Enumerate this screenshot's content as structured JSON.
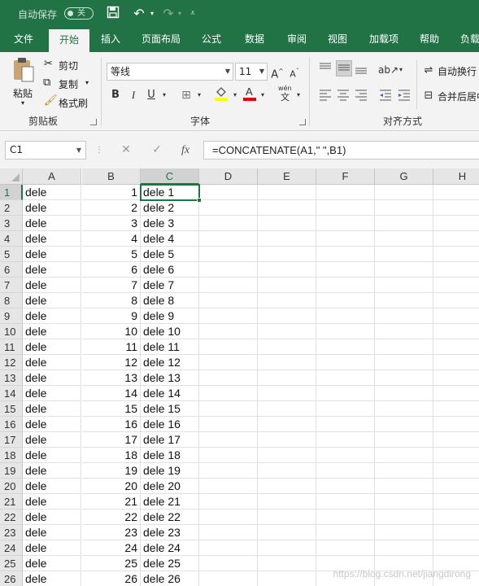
{
  "titlebar": {
    "autosave_label": "自动保存",
    "autosave_state": "关"
  },
  "tabs": [
    "文件",
    "开始",
    "插入",
    "页面布局",
    "公式",
    "数据",
    "审阅",
    "视图",
    "加载项",
    "帮助",
    "负载"
  ],
  "ribbon": {
    "clipboard": {
      "paste": "粘贴",
      "cut": "剪切",
      "copy": "复制",
      "format_painter": "格式刷",
      "group_label": "剪贴板"
    },
    "font": {
      "font_name": "等线",
      "font_size": "11",
      "bold": "B",
      "italic": "I",
      "underline": "U",
      "group_label": "字体"
    },
    "alignment": {
      "wrap_text": "自动换行",
      "merge_center": "合并后居中",
      "group_label": "对齐方式"
    }
  },
  "formula_bar": {
    "name_box": "C1",
    "formula": "=CONCATENATE(A1,\" \",B1)"
  },
  "sheet": {
    "columns": [
      "A",
      "B",
      "C",
      "D",
      "E",
      "F",
      "G",
      "H"
    ],
    "selected_cell": "C1",
    "rows": [
      {
        "n": "1",
        "a": "dele",
        "b": "1",
        "c": "dele 1"
      },
      {
        "n": "2",
        "a": "dele",
        "b": "2",
        "c": "dele 2"
      },
      {
        "n": "3",
        "a": "dele",
        "b": "3",
        "c": "dele 3"
      },
      {
        "n": "4",
        "a": "dele",
        "b": "4",
        "c": "dele 4"
      },
      {
        "n": "5",
        "a": "dele",
        "b": "5",
        "c": "dele 5"
      },
      {
        "n": "6",
        "a": "dele",
        "b": "6",
        "c": "dele 6"
      },
      {
        "n": "7",
        "a": "dele",
        "b": "7",
        "c": "dele 7"
      },
      {
        "n": "8",
        "a": "dele",
        "b": "8",
        "c": "dele 8"
      },
      {
        "n": "9",
        "a": "dele",
        "b": "9",
        "c": "dele 9"
      },
      {
        "n": "10",
        "a": "dele",
        "b": "10",
        "c": "dele 10"
      },
      {
        "n": "11",
        "a": "dele",
        "b": "11",
        "c": "dele 11"
      },
      {
        "n": "12",
        "a": "dele",
        "b": "12",
        "c": "dele 12"
      },
      {
        "n": "13",
        "a": "dele",
        "b": "13",
        "c": "dele 13"
      },
      {
        "n": "14",
        "a": "dele",
        "b": "14",
        "c": "dele 14"
      },
      {
        "n": "15",
        "a": "dele",
        "b": "15",
        "c": "dele 15"
      },
      {
        "n": "16",
        "a": "dele",
        "b": "16",
        "c": "dele 16"
      },
      {
        "n": "17",
        "a": "dele",
        "b": "17",
        "c": "dele 17"
      },
      {
        "n": "18",
        "a": "dele",
        "b": "18",
        "c": "dele 18"
      },
      {
        "n": "19",
        "a": "dele",
        "b": "19",
        "c": "dele 19"
      },
      {
        "n": "20",
        "a": "dele",
        "b": "20",
        "c": "dele 20"
      },
      {
        "n": "21",
        "a": "dele",
        "b": "21",
        "c": "dele 21"
      },
      {
        "n": "22",
        "a": "dele",
        "b": "22",
        "c": "dele 22"
      },
      {
        "n": "23",
        "a": "dele",
        "b": "23",
        "c": "dele 23"
      },
      {
        "n": "24",
        "a": "dele",
        "b": "24",
        "c": "dele 24"
      },
      {
        "n": "25",
        "a": "dele",
        "b": "25",
        "c": "dele 25"
      },
      {
        "n": "26",
        "a": "dele",
        "b": "26",
        "c": "dele 26"
      }
    ]
  },
  "watermark": "https://blog.csdn.net/jiangdirong",
  "colors": {
    "accent": "#217346",
    "ribbon_bg": "#f3f3f3",
    "header_bg": "#e6e6e6"
  }
}
